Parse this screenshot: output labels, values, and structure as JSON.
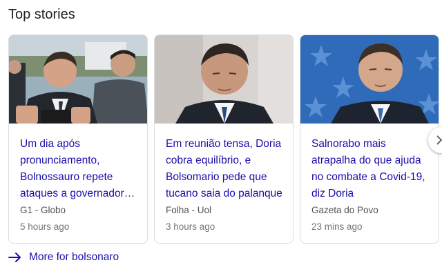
{
  "section": {
    "title": "Top stories"
  },
  "stories": [
    {
      "headline": "Um dia após pronunciamento, Bolnossauro repete ataques a governador…",
      "source": "G1 - Globo",
      "time": "5 hours ago"
    },
    {
      "headline": "Em reunião tensa, Doria cobra equilíbrio, e Bolsomario pede que tucano saia do palanque",
      "source": "Folha - Uol",
      "time": "3 hours ago"
    },
    {
      "headline": "Salnorabo mais atrapalha do que ajuda no combate a Covid-19, diz Doria",
      "source": "Gazeta do Povo",
      "time": "23 mins ago"
    }
  ],
  "more_link": {
    "label": "More for bolsonaro"
  },
  "icons": {
    "arrow": "arrow-right-icon",
    "next": "chevron-right-icon"
  },
  "colors": {
    "link": "#1a0dab",
    "secondary": "#70757a",
    "border": "#dadce0"
  }
}
